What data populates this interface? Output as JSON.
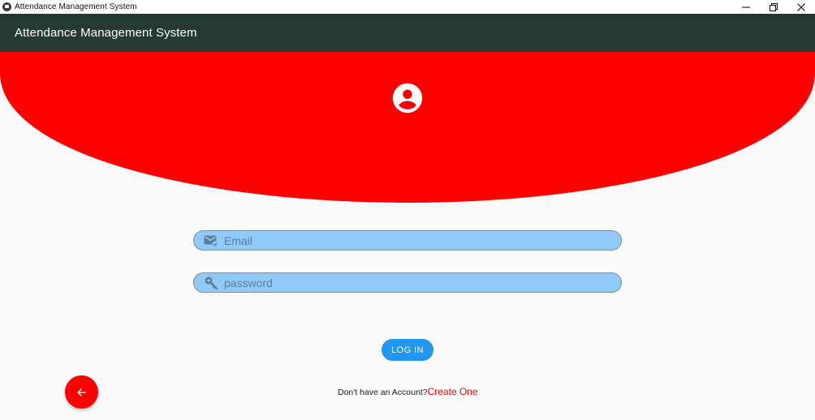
{
  "window": {
    "title": "Attendance Management System",
    "controls": [
      "minimize-icon",
      "restore-icon",
      "close-icon"
    ]
  },
  "appbar": {
    "title": "Attendance Management System",
    "background": "#253a32"
  },
  "header": {
    "color": "#ff0000",
    "icon": "account-circle-icon"
  },
  "form": {
    "email": {
      "placeholder": "Email",
      "value": "",
      "icon": "mark-email-read-icon"
    },
    "password": {
      "placeholder": "password",
      "value": "",
      "icon": "key-icon"
    },
    "field_color": "#90caf9",
    "login_label": "LOG IN",
    "login_color": "#2196f3"
  },
  "footer": {
    "prompt": "Don't have an Account?",
    "link": "Create One",
    "back_icon": "arrow-back-icon",
    "fab_color": "#ff0000"
  }
}
